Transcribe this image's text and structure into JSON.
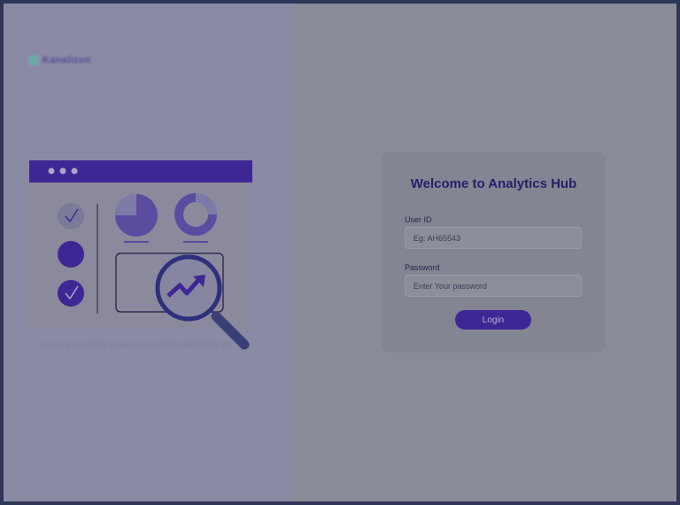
{
  "brand": {
    "name": "Kanalizon",
    "icon": "logo-mark-icon"
  },
  "illustration": {
    "icons": [
      "browser-window-icon",
      "checkmark-icon",
      "pie-chart-icon",
      "donut-chart-icon",
      "magnifier-icon",
      "trend-arrow-icon"
    ],
    "colors": {
      "purple": "#3e2795",
      "light": "#7b7b97"
    }
  },
  "caption": "Lorem ipsum dolor sit amet consectetur adipiscing elit",
  "login": {
    "title": "Welcome to Analytics Hub",
    "user_id_label": "User ID",
    "user_id_placeholder": "Eg: AH65543",
    "user_id_value": "",
    "password_label": "Password",
    "password_placeholder": "Enter Your password",
    "password_value": "",
    "button_label": "Login"
  },
  "colors": {
    "accent": "#3e2795",
    "title": "#24206a"
  }
}
